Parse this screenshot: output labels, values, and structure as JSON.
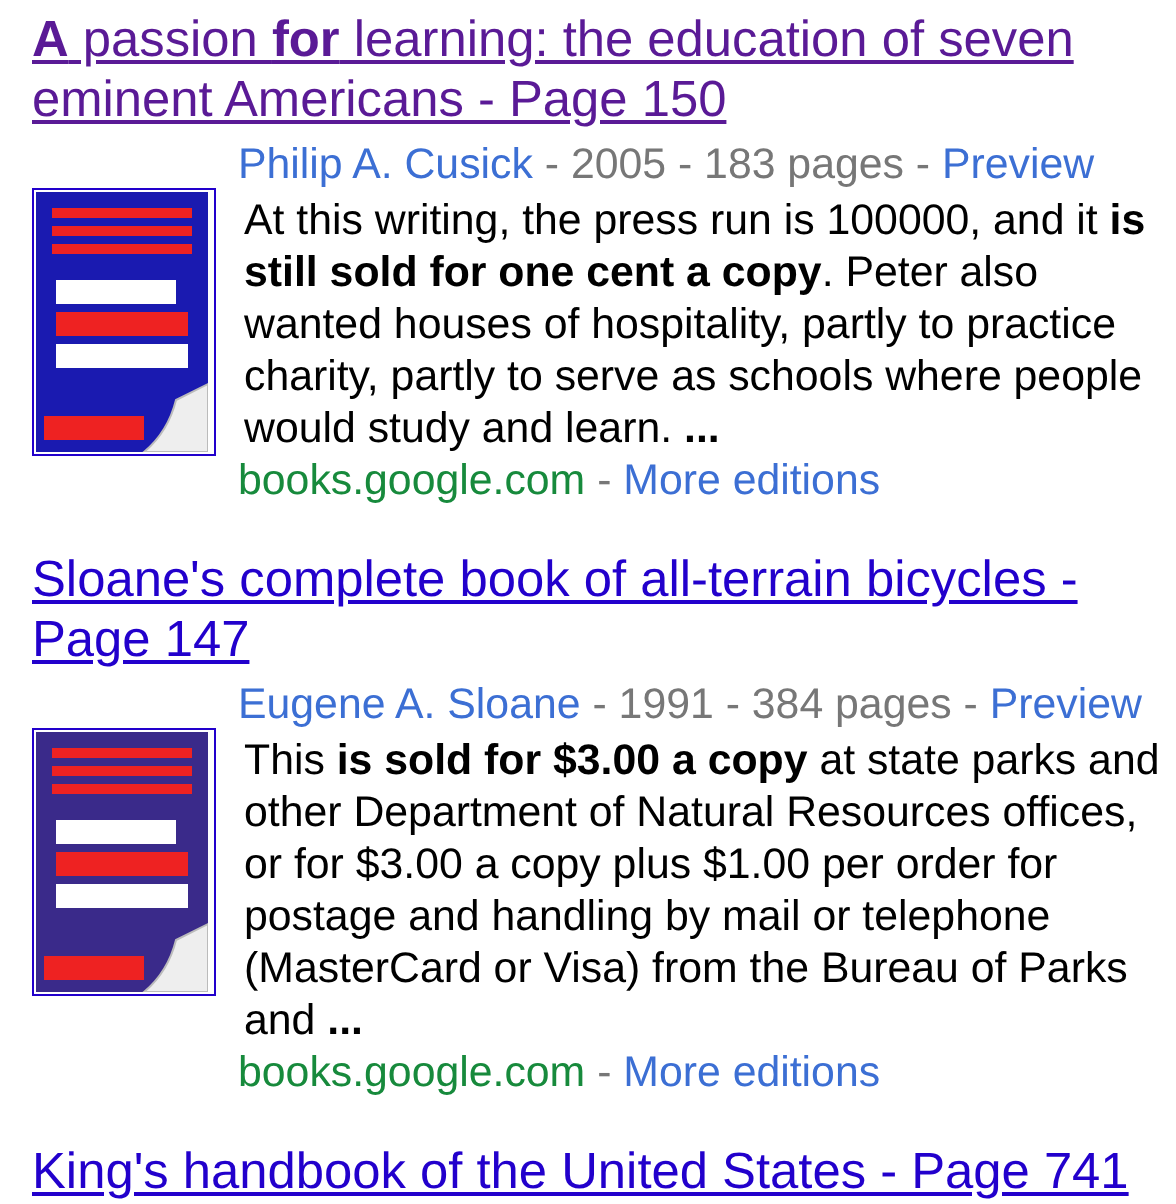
{
  "results": [
    {
      "title": "**A** passion **for** learning: the education of seven eminent Americans - Page 150",
      "visited": true,
      "cover": {
        "color": "#1a1ab0"
      },
      "meta": [
        {
          "text": "Philip A. Cusick",
          "kind": "link"
        },
        {
          "text": "2005",
          "kind": "plain"
        },
        {
          "text": "183 pages",
          "kind": "plain"
        },
        {
          "text": "Preview",
          "kind": "link"
        }
      ],
      "snippet": "At this writing, the press run is 100000, and it **is still sold for one cent a copy**. Peter also wanted houses of hospitality, partly to practice charity, partly to serve as schools where people would study and learn. **...**",
      "source": [
        {
          "text": "books.google.com",
          "kind": "url"
        },
        {
          "text": "More editions",
          "kind": "link"
        }
      ]
    },
    {
      "title": "Sloane's complete book of all-terrain bicycles - Page 147",
      "visited": false,
      "cover": {
        "color": "#3a2a8a"
      },
      "meta": [
        {
          "text": "Eugene A. Sloane",
          "kind": "link"
        },
        {
          "text": "1991",
          "kind": "plain"
        },
        {
          "text": "384 pages",
          "kind": "plain"
        },
        {
          "text": "Preview",
          "kind": "link"
        }
      ],
      "snippet": "This **is sold for $3.00 a copy** at state parks and other Department of Natural Resources offices, or for $3.00 a copy plus $1.00 per order for postage and handling by mail or telephone (MasterCard or Visa) from the Bureau of Parks and **...**",
      "source": [
        {
          "text": "books.google.com",
          "kind": "url"
        },
        {
          "text": "More editions",
          "kind": "link"
        }
      ]
    },
    {
      "title": "King's handbook of the United States - Page 741",
      "visited": false
    }
  ],
  "separator": "-"
}
